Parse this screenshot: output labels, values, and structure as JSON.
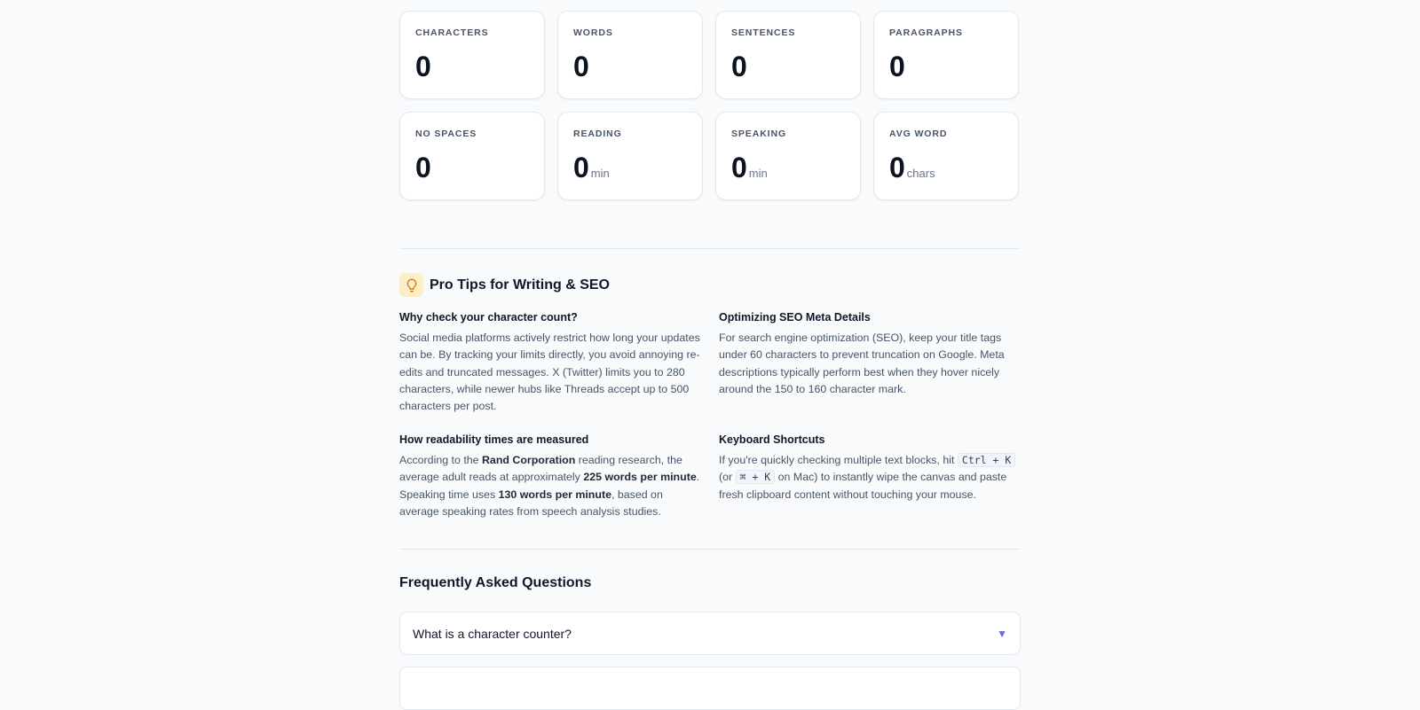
{
  "stats": [
    {
      "label": "CHARACTERS",
      "value": "0",
      "unit": ""
    },
    {
      "label": "WORDS",
      "value": "0",
      "unit": ""
    },
    {
      "label": "SENTENCES",
      "value": "0",
      "unit": ""
    },
    {
      "label": "PARAGRAPHS",
      "value": "0",
      "unit": ""
    },
    {
      "label": "NO SPACES",
      "value": "0",
      "unit": ""
    },
    {
      "label": "READING",
      "value": "0",
      "unit": "min"
    },
    {
      "label": "SPEAKING",
      "value": "0",
      "unit": "min"
    },
    {
      "label": "AVG WORD",
      "value": "0",
      "unit": "chars"
    }
  ],
  "tips": {
    "title": "Pro Tips for Writing & SEO",
    "icon": "lightbulb-icon",
    "char_count": {
      "title": "Why check your character count?",
      "body": "Social media platforms actively restrict how long your updates can be. By tracking your limits directly, you avoid annoying re-edits and truncated messages. X (Twitter) limits you to 280 characters, while newer hubs like Threads accept up to 500 characters per post."
    },
    "seo": {
      "title": "Optimizing SEO Meta Details",
      "body": "For search engine optimization (SEO), keep your title tags under 60 characters to prevent truncation on Google. Meta descriptions typically perform best when they hover nicely around the 150 to 160 character mark."
    },
    "readability": {
      "title": "How readability times are measured",
      "t1": "According to the ",
      "b1": "Rand Corporation",
      "t2": " reading research, the average adult reads at approximately ",
      "b2": "225 words per minute",
      "t3": ". Speaking time uses ",
      "b3": "130 words per minute",
      "t4": ", based on average speaking rates from speech analysis studies."
    },
    "shortcuts": {
      "title": "Keyboard Shortcuts",
      "t1": "If you're quickly checking multiple text blocks, hit ",
      "k1": "Ctrl + K",
      "t2": " (or ",
      "k2": "⌘ + K",
      "t3": " on Mac) to instantly wipe the canvas and paste fresh clipboard content without touching your mouse."
    }
  },
  "faq": {
    "title": "Frequently Asked Questions",
    "items": [
      {
        "question": "What is a character counter?"
      },
      {
        "question": ""
      }
    ]
  },
  "colors": {
    "background": "#f8fafc",
    "accent": "#6366f1",
    "bulb_bg": "#fdeecb",
    "bulb_stroke": "#d97706"
  }
}
